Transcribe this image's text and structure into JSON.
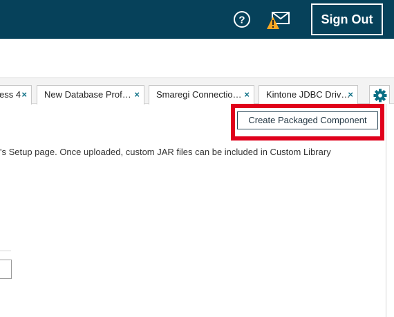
{
  "header": {
    "signout_label": "Sign Out",
    "icons": {
      "help": "help-circle-icon",
      "mail": "envelope-warning-icon"
    },
    "colors": {
      "background": "#06415a",
      "warning": "#f5a623"
    }
  },
  "tabs": [
    {
      "label": "ess 4",
      "close": "×"
    },
    {
      "label": "New Database Prof…",
      "close": "×"
    },
    {
      "label": "Smaregi Connectio…",
      "close": "×"
    },
    {
      "label": "Kintone JDBC Driv…",
      "close": "×"
    }
  ],
  "toolbar": {
    "create_packaged_component_label": "Create Packaged Component",
    "gear_icon": "gear-icon"
  },
  "content": {
    "description": "'s Setup page. Once uploaded, custom JAR files can be included in Custom Library"
  },
  "highlight_color": "#e0001b"
}
